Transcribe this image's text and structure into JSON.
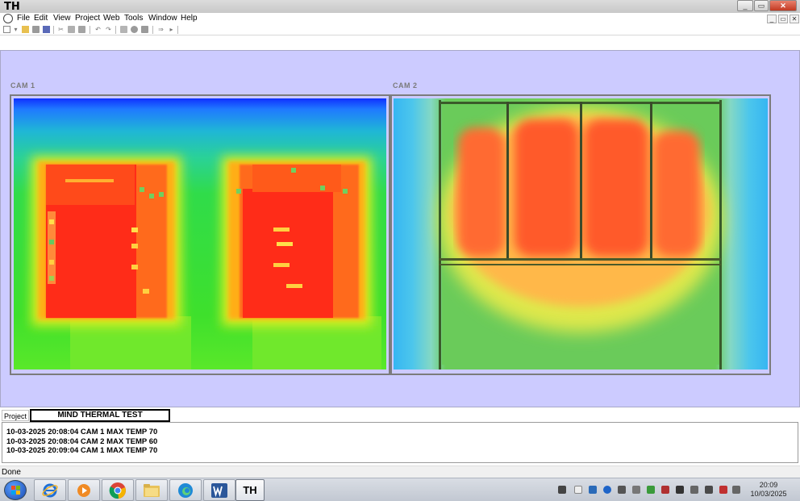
{
  "window": {
    "title": "TH",
    "controls": {
      "minimize": "_",
      "restore": "▭",
      "close": "✕"
    }
  },
  "menu": {
    "items": [
      "File",
      "Edit",
      "View",
      "Project",
      "Web",
      "Tools",
      "Window",
      "Help"
    ],
    "mdi_controls": {
      "minimize": "_",
      "restore": "▭",
      "close": "✕"
    }
  },
  "cameras": {
    "cam1": {
      "label": "CAM 1"
    },
    "cam2": {
      "label": "CAM 2"
    }
  },
  "project": {
    "tab_label": "Project",
    "name": "MIND THERMAL TEST"
  },
  "log": {
    "lines": [
      "10-03-2025 20:08:04 CAM 1 MAX TEMP 70",
      "10-03-2025 20:08:04 CAM 2 MAX TEMP 60",
      "10-03-2025 20:09:04 CAM 1 MAX TEMP 70"
    ]
  },
  "status": {
    "text": "Done"
  },
  "taskbar": {
    "active_app_label": "TH",
    "clock": {
      "time": "20:09",
      "date": "10/03/2025"
    }
  },
  "colors": {
    "main_background": "#cccbff",
    "hot": "#ff2a1a",
    "warm": "#ff9a1a",
    "mild": "#f6f01c",
    "cool": "#35e02a",
    "cold": "#1a3cff"
  }
}
